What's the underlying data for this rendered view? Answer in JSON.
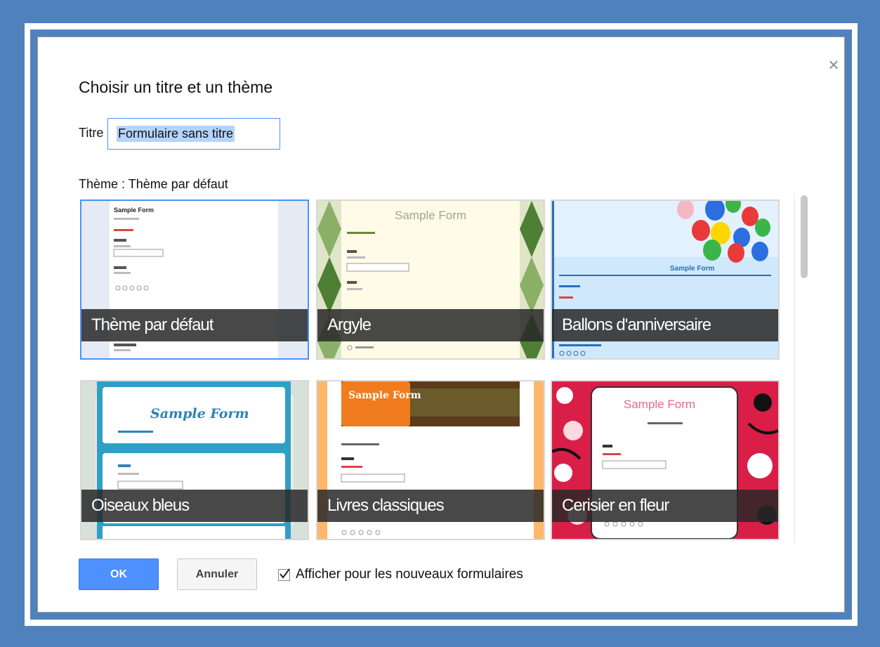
{
  "dialog": {
    "title": "Choisir un titre et un thème",
    "close_symbol": "×",
    "title_field_label": "Titre",
    "title_field_value": "Formulaire sans titre",
    "theme_label": "Thème : Thème par défaut"
  },
  "themes": [
    {
      "label": "Thème par défaut",
      "selected": true,
      "preview_title": "Sample Form"
    },
    {
      "label": "Argyle",
      "selected": false,
      "preview_title": "Sample Form"
    },
    {
      "label": "Ballons d'anniversaire",
      "selected": false,
      "preview_title": "Sample Form"
    },
    {
      "label": "Oiseaux bleus",
      "selected": false,
      "preview_title": "Sample Form"
    },
    {
      "label": "Livres classiques",
      "selected": false,
      "preview_title": "Sample Form"
    },
    {
      "label": "Cerisier en fleur",
      "selected": false,
      "preview_title": "Sample Form"
    }
  ],
  "footer": {
    "ok_label": "OK",
    "cancel_label": "Annuler",
    "show_for_new_label": "Afficher pour les nouveaux formulaires",
    "show_for_new_checked": true
  },
  "colors": {
    "frame_blue": "#4f81bd",
    "accent_blue": "#4d90fe",
    "label_bar": "#282828"
  }
}
